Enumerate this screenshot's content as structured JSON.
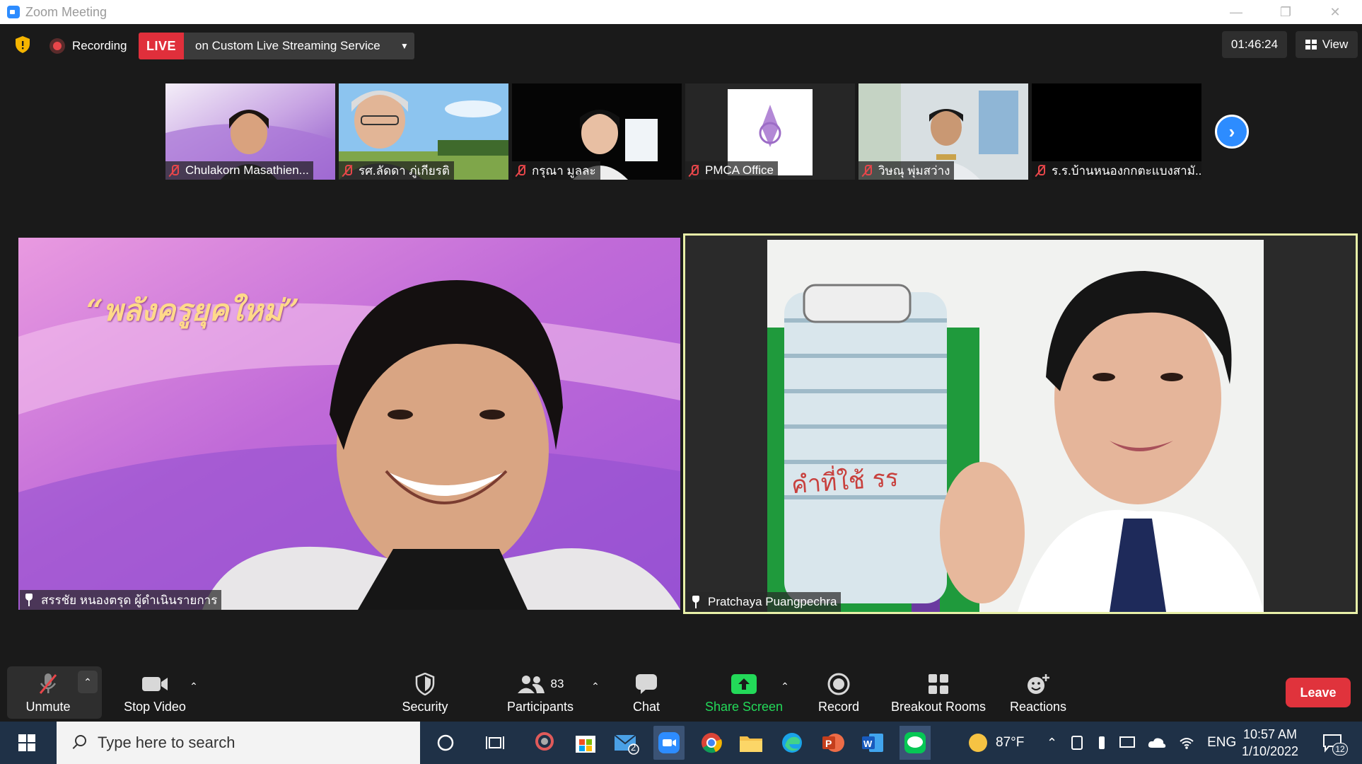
{
  "window": {
    "title": "Zoom Meeting",
    "minimize": "—",
    "restore": "❐",
    "close": "✕"
  },
  "topbar": {
    "recording_label": "Recording",
    "live_badge": "LIVE",
    "live_service": "on Custom Live Streaming Service",
    "timer": "01:46:24",
    "view_label": "View"
  },
  "thumbnails": [
    {
      "name": "Chulakorn Masathien..."
    },
    {
      "name": "รศ.ลัดดา ภู่เกียรติ"
    },
    {
      "name": "กรุณา มูลละ"
    },
    {
      "name": "PMCA Office"
    },
    {
      "name": "วิษณุ พุ่มสว่าง"
    },
    {
      "name": "ร.ร.บ้านหนองกกตะแบงสามั..."
    }
  ],
  "main_tiles": [
    {
      "name": "สรรชัย หนองตรุด ผู้ดำเนินรายการ",
      "banner_text": "“พลังครูยุคใหม่”"
    },
    {
      "name": "Pratchaya Puangpechra",
      "book_text": "คำที่ใช้ รร"
    }
  ],
  "toolbar": {
    "unmute": "Unmute",
    "stop_video": "Stop Video",
    "security": "Security",
    "participants": "Participants",
    "participants_count": "83",
    "chat": "Chat",
    "share_screen": "Share Screen",
    "record": "Record",
    "breakout_rooms": "Breakout Rooms",
    "reactions": "Reactions",
    "leave": "Leave"
  },
  "taskbar": {
    "search_placeholder": "Type here to search",
    "mail_badge": "2",
    "weather_temp": "87°F",
    "language": "ENG",
    "time": "10:57 AM",
    "date": "1/10/2022",
    "notification_count": "12"
  },
  "colors": {
    "zoom_blue": "#2d8cff",
    "live_red": "#e02f3b",
    "leave_red": "#e0333c",
    "share_green": "#23d959",
    "active_speaker_border": "#e8f0a8"
  }
}
